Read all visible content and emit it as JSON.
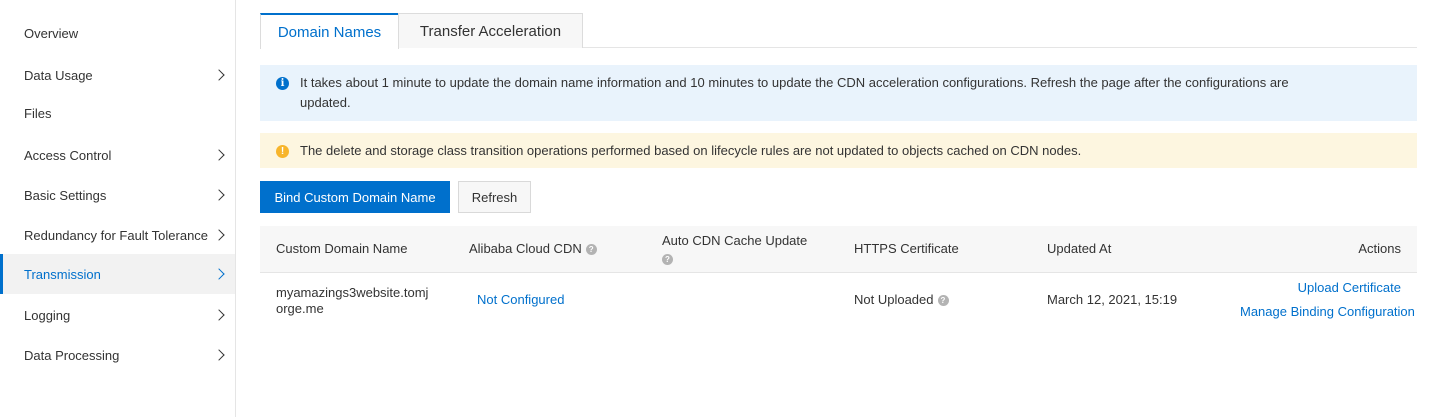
{
  "sidebar": {
    "items": [
      {
        "label": "Overview"
      },
      {
        "label": "Data Usage"
      },
      {
        "label": "Files"
      },
      {
        "label": "Access Control"
      },
      {
        "label": "Basic Settings"
      },
      {
        "label": "Redundancy for Fault Tolerance"
      },
      {
        "label": "Transmission"
      },
      {
        "label": "Logging"
      },
      {
        "label": "Data Processing"
      }
    ]
  },
  "tabs": [
    {
      "label": "Domain Names"
    },
    {
      "label": "Transfer Acceleration"
    }
  ],
  "notices": {
    "info_line1": "It takes about 1 minute to update the domain name information and 10 minutes to update the CDN acceleration configurations. Refresh the page after the configurations are",
    "info_line2": "updated.",
    "warning": "The delete and storage class transition operations performed based on lifecycle rules are not updated to objects cached on CDN nodes."
  },
  "toolbar": {
    "bind_label": "Bind Custom Domain Name",
    "refresh_label": "Refresh"
  },
  "table": {
    "columns": {
      "domain": "Custom Domain Name",
      "cdn": "Alibaba Cloud CDN",
      "cache": "Auto CDN Cache Update",
      "https": "HTTPS Certificate",
      "updated": "Updated At",
      "actions": "Actions"
    },
    "rows": [
      {
        "domain_line1": "myamazings3website.tomj",
        "domain_line2": "orge.me",
        "cdn": "Not Configured",
        "cache": "",
        "https": "Not Uploaded",
        "updated": "March 12, 2021, 15:19",
        "action1": "Upload Certificate",
        "action2": "Manage Binding Configuration"
      }
    ]
  },
  "colors": {
    "accent": "#0070cc",
    "info_bg": "#e9f3fc",
    "warning_bg": "#fdf6e0",
    "warning_icon": "#f7b52c"
  }
}
